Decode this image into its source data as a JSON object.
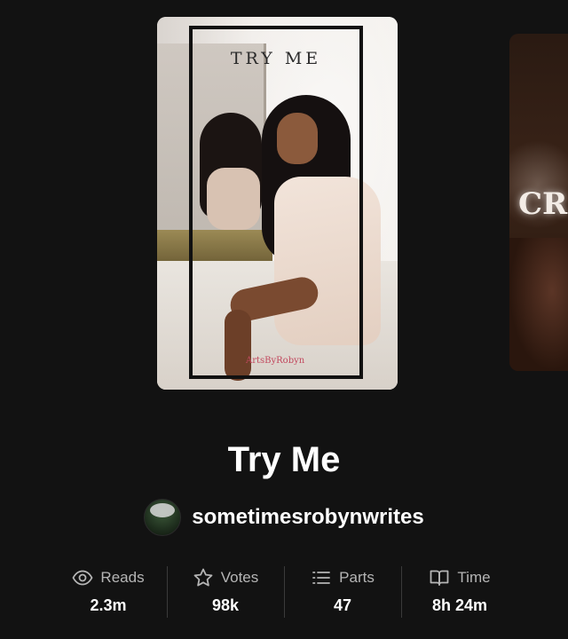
{
  "carousel": {
    "current_cover": {
      "title_text": "TRY ME",
      "watermark": "ArtsByRobyn"
    },
    "next_cover": {
      "title_text": "CR"
    }
  },
  "story": {
    "title": "Try Me",
    "author": "sometimesrobynwrites"
  },
  "stats": [
    {
      "icon": "eye-icon",
      "label": "Reads",
      "value": "2.3m"
    },
    {
      "icon": "star-icon",
      "label": "Votes",
      "value": "98k"
    },
    {
      "icon": "list-icon",
      "label": "Parts",
      "value": "47"
    },
    {
      "icon": "book-icon",
      "label": "Time",
      "value": "8h 24m"
    }
  ],
  "colors": {
    "background": "#121212",
    "text_primary": "#ffffff",
    "text_secondary": "#b5b5b5",
    "divider": "#3a3a3a"
  }
}
